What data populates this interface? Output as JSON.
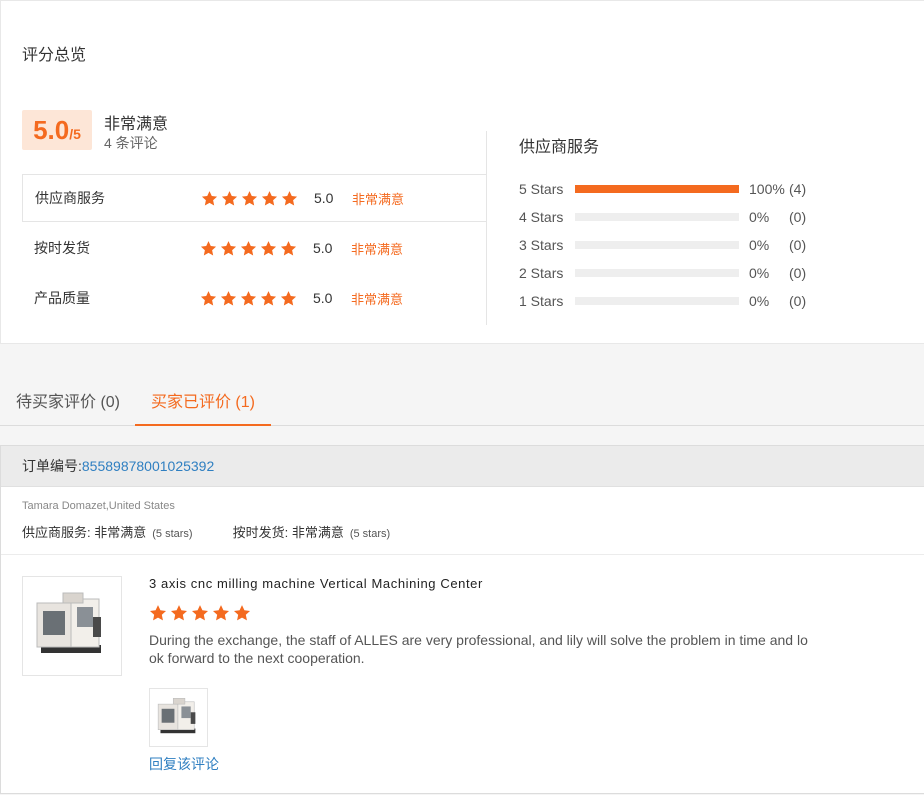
{
  "summary": {
    "title": "评分总览",
    "score": "5.0",
    "score_suffix": "/5",
    "overall_label": "非常满意",
    "review_count": "4 条评论",
    "ratings": [
      {
        "label": "供应商服务",
        "score": "5.0",
        "word": "非常满意",
        "stars": 5
      },
      {
        "label": "按时发货",
        "score": "5.0",
        "word": "非常满意",
        "stars": 5
      },
      {
        "label": "产品质量",
        "score": "5.0",
        "word": "非常满意",
        "stars": 5
      }
    ],
    "distribution_title": "供应商服务",
    "distribution": [
      {
        "label": "5  Stars",
        "percent": 100,
        "pct_text": "100%",
        "count": "(4)"
      },
      {
        "label": "4  Stars",
        "percent": 0,
        "pct_text": "0%",
        "count": "(0)"
      },
      {
        "label": "3  Stars",
        "percent": 0,
        "pct_text": "0%",
        "count": "(0)"
      },
      {
        "label": "2  Stars",
        "percent": 0,
        "pct_text": "0%",
        "count": "(0)"
      },
      {
        "label": "1  Stars",
        "percent": 0,
        "pct_text": "0%",
        "count": "(0)"
      }
    ]
  },
  "tabs": {
    "pending": "待买家评价 (0)",
    "done": "买家已评价 (1)"
  },
  "review": {
    "order_label": "订单编号: ",
    "order_no": "85589878001025392",
    "buyer": "Tamara Domazet,United States",
    "service_label": "供应商服务: ",
    "service_value": "非常满意",
    "service_note": "(5 stars)",
    "delivery_label": "按时发货: ",
    "delivery_value": "非常满意",
    "delivery_note": "(5 stars)",
    "product_title": "3 axis cnc milling machine Vertical Machining Center",
    "stars": 5,
    "text": "During the exchange, the staff of ALLES are very professional, and lily will solve the problem in time and look forward to the next cooperation.",
    "reply_link": "回复该评论"
  },
  "colors": {
    "accent": "#f46a1f",
    "link": "#2f7fc1",
    "score_bg": "#fde6d7"
  },
  "icons": {
    "star": "star-icon",
    "product_image": "cnc-machine-image"
  }
}
